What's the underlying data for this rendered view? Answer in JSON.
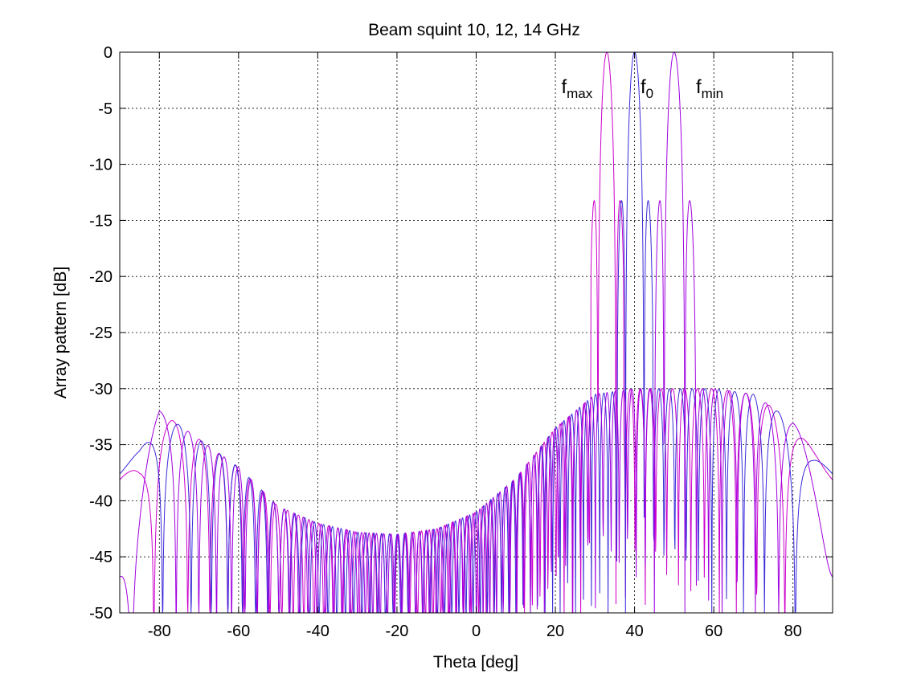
{
  "chart_data": {
    "type": "line",
    "title": "Beam squint 10, 12, 14 GHz",
    "xlabel": "Theta [deg]",
    "ylabel": "Array pattern [dB]",
    "xlim": [
      -90,
      90
    ],
    "ylim": [
      -50,
      0
    ],
    "xticks": [
      -80,
      -60,
      -40,
      -20,
      0,
      20,
      40,
      60,
      80
    ],
    "yticks": [
      0,
      -5,
      -10,
      -15,
      -20,
      -25,
      -30,
      -35,
      -40,
      -45,
      -50
    ],
    "grid": true,
    "series": [
      {
        "key": "f_max",
        "color": "#cc00cc",
        "peak_deg": 33,
        "peak_db": 0,
        "width": 1.0
      },
      {
        "key": "f_0",
        "color": "#3a2bd8",
        "peak_deg": 40,
        "peak_db": 0,
        "width": 1.0
      },
      {
        "key": "f_min",
        "color": "#a000e0",
        "peak_deg": 50,
        "peak_db": 0,
        "width": 1.0
      }
    ],
    "sidelobe_envelope": {
      "theta_deg": [
        -90,
        -85,
        -80,
        -70,
        -60,
        -50,
        -40,
        -30,
        -20,
        -10,
        0,
        10,
        20,
        30,
        40,
        50,
        60,
        70,
        80,
        85,
        90
      ],
      "level_db": [
        -37.5,
        -35.5,
        -32,
        -34.5,
        -37,
        -40.5,
        -42,
        -42.8,
        -43,
        -42.5,
        -41,
        -38,
        -33.5,
        -30.5,
        -30,
        -30,
        -30,
        -30.5,
        -33,
        -35.5,
        -37.5
      ]
    },
    "floor_db": -50,
    "annotations": [
      {
        "label_main": "f",
        "label_sub": "max",
        "theta_deg": 21.5,
        "db": -2.8
      },
      {
        "label_main": "f",
        "label_sub": "0",
        "theta_deg": 41.5,
        "db": -2.8
      },
      {
        "label_main": "f",
        "label_sub": "min",
        "theta_deg": 55.5,
        "db": -2.8
      }
    ]
  }
}
